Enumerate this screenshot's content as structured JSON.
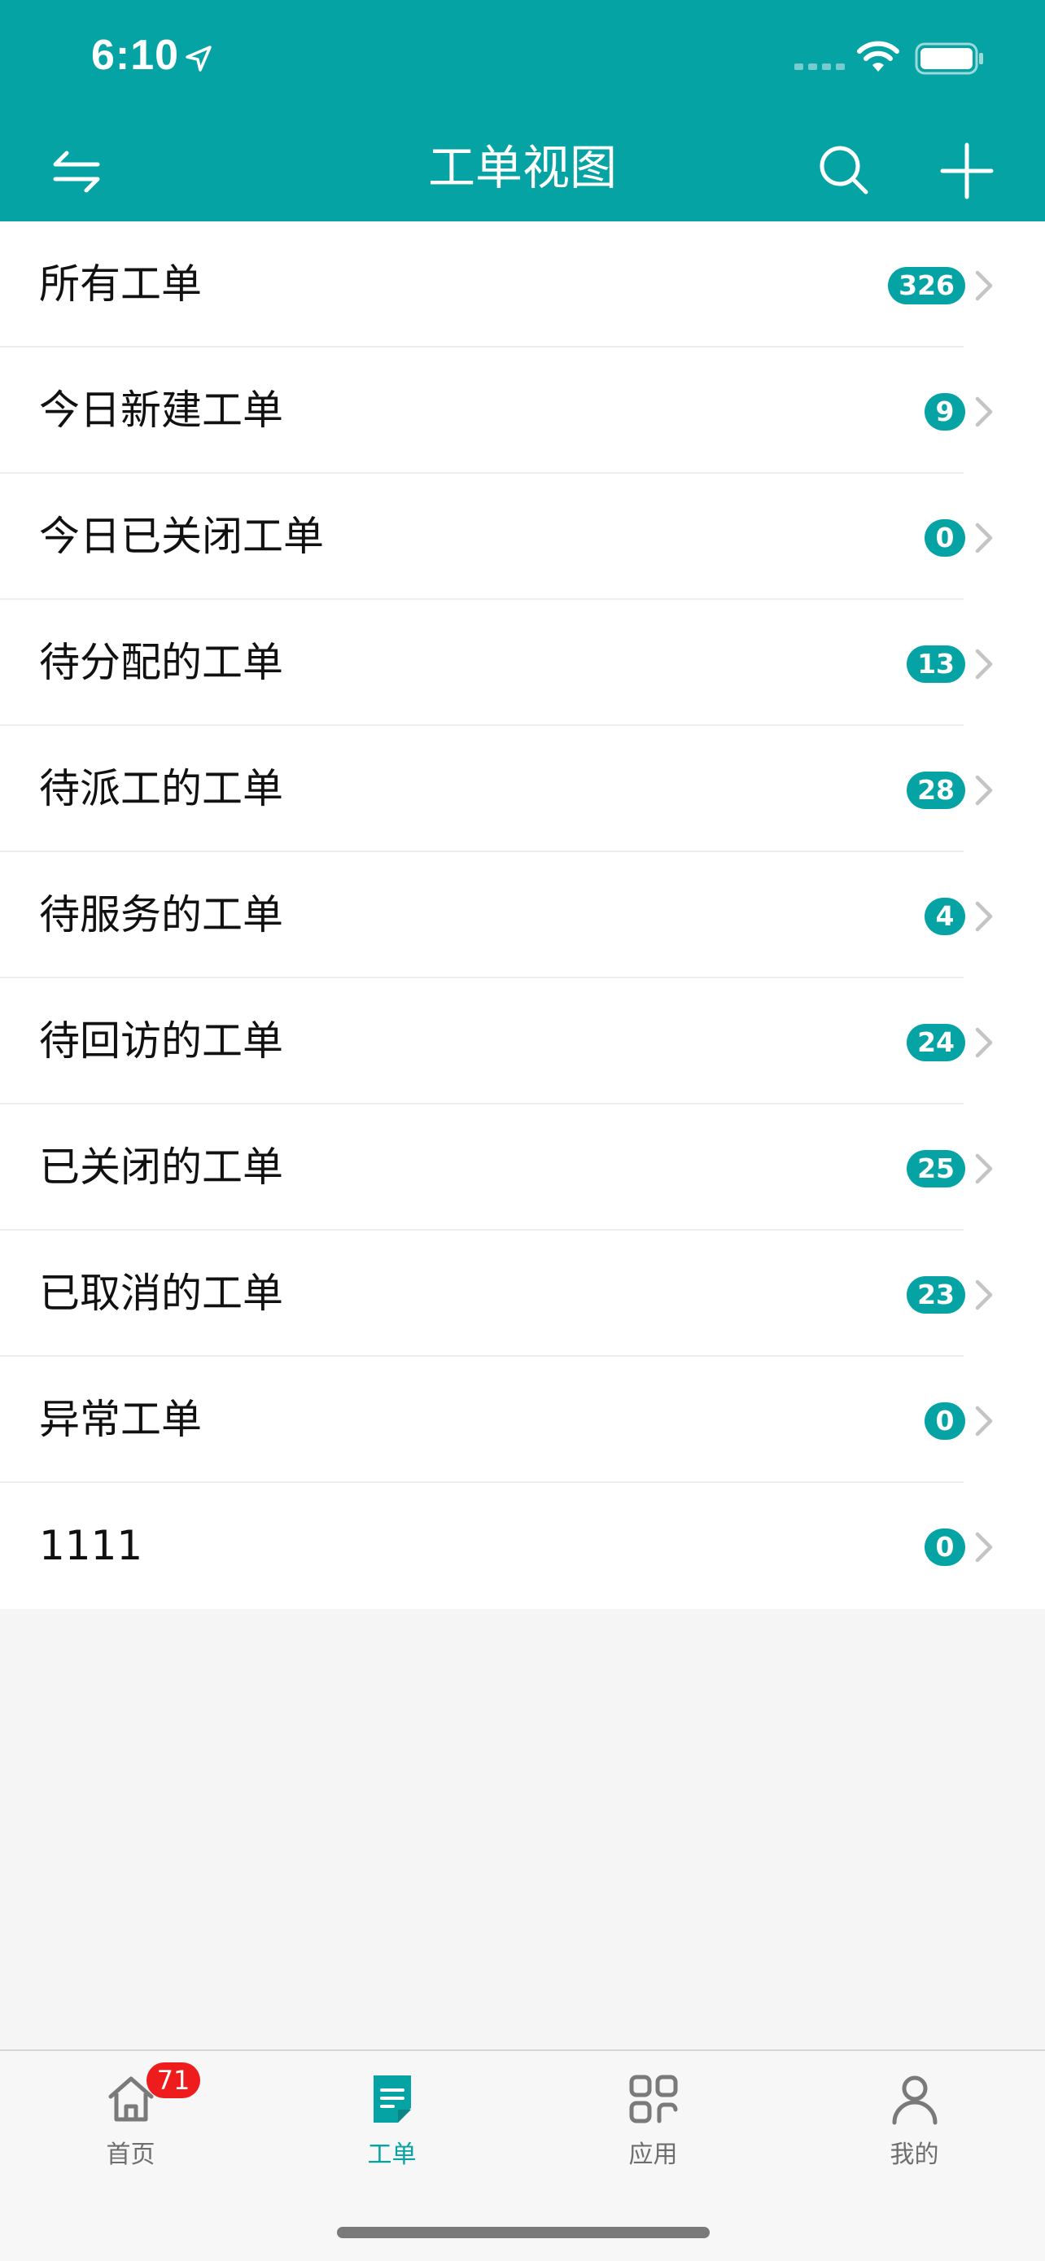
{
  "status_bar": {
    "time": "6:10"
  },
  "nav": {
    "title": "工单视图"
  },
  "list": [
    {
      "label": "所有工单",
      "count": "326"
    },
    {
      "label": "今日新建工单",
      "count": "9"
    },
    {
      "label": "今日已关闭工单",
      "count": "0"
    },
    {
      "label": "待分配的工单",
      "count": "13"
    },
    {
      "label": "待派工的工单",
      "count": "28"
    },
    {
      "label": "待服务的工单",
      "count": "4"
    },
    {
      "label": "待回访的工单",
      "count": "24"
    },
    {
      "label": "已关闭的工单",
      "count": "25"
    },
    {
      "label": "已取消的工单",
      "count": "23"
    },
    {
      "label": "异常工单",
      "count": "0"
    },
    {
      "label": "1111",
      "count": "0"
    }
  ],
  "tabs": [
    {
      "label": "首页",
      "badge": "71",
      "icon": "home-icon"
    },
    {
      "label": "工单",
      "icon": "work-order-icon",
      "active": true
    },
    {
      "label": "应用",
      "icon": "apps-grid-icon"
    },
    {
      "label": "我的",
      "icon": "profile-icon"
    }
  ],
  "colors": {
    "accent": "#05a3a4",
    "badge_red": "#ee1c1c",
    "background": "#f5f5f5"
  }
}
